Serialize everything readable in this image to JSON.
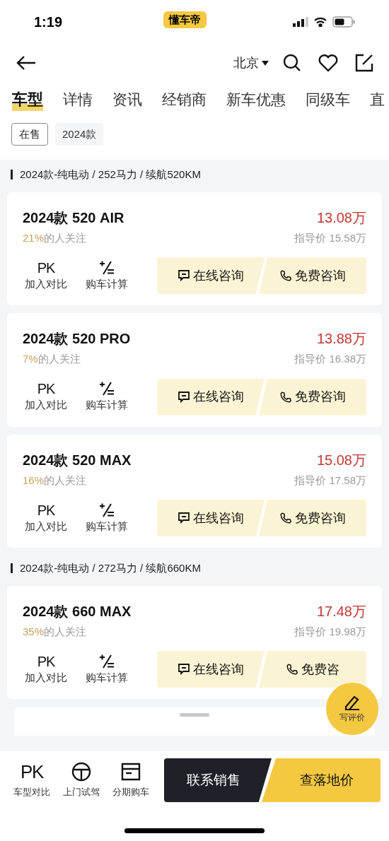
{
  "status_bar": {
    "time": "1:19",
    "app_badge": "懂车帝"
  },
  "nav": {
    "city": "北京"
  },
  "tabs": [
    {
      "label": "车型",
      "selected": true
    },
    {
      "label": "详情",
      "selected": false
    },
    {
      "label": "资讯",
      "selected": false
    },
    {
      "label": "经销商",
      "selected": false
    },
    {
      "label": "新车优惠",
      "selected": false
    },
    {
      "label": "同级车",
      "selected": false
    },
    {
      "label": "直",
      "selected": false
    }
  ],
  "filters": [
    {
      "label": "在售",
      "selected": true
    },
    {
      "label": "2024款",
      "selected": false
    }
  ],
  "groups": [
    {
      "header": "2024款-纯电动 / 252马力 / 续航520KM",
      "cars": [
        {
          "name": "2024款 520 AIR",
          "price": "13.08万",
          "share": "21%",
          "share_label": "的人关注",
          "guide": "指导价 15.58万",
          "compare_icon": "PK",
          "compare": "加入对比",
          "calc": "购车计算",
          "consult": "在线咨询",
          "call": "免费咨询"
        },
        {
          "name": "2024款 520 PRO",
          "price": "13.88万",
          "share": "7%",
          "share_label": "的人关注",
          "guide": "指导价 16.38万",
          "compare_icon": "PK",
          "compare": "加入对比",
          "calc": "购车计算",
          "consult": "在线咨询",
          "call": "免费咨询"
        },
        {
          "name": "2024款 520 MAX",
          "price": "15.08万",
          "share": "16%",
          "share_label": "的人关注",
          "guide": "指导价 17.58万",
          "compare_icon": "PK",
          "compare": "加入对比",
          "calc": "购车计算",
          "consult": "在线咨询",
          "call": "免费咨询"
        }
      ]
    },
    {
      "header": "2024款-纯电动 / 272马力 / 续航660KM",
      "cars": [
        {
          "name": "2024款 660 MAX",
          "price": "17.48万",
          "share": "35%",
          "share_label": "的人关注",
          "guide": "指导价 19.98万",
          "compare_icon": "PK",
          "compare": "加入对比",
          "calc": "购车计算",
          "consult": "在线咨询",
          "call": "免费咨"
        }
      ]
    }
  ],
  "float_button": {
    "label": "写评价"
  },
  "bottom_bar": {
    "items": [
      {
        "kind": "pk",
        "icon_text": "PK",
        "label": "车型对比"
      },
      {
        "kind": "drive",
        "label": "上门试驾"
      },
      {
        "kind": "loan",
        "label": "分期购车"
      }
    ],
    "contact": "联系销售",
    "price": "查落地价"
  }
}
